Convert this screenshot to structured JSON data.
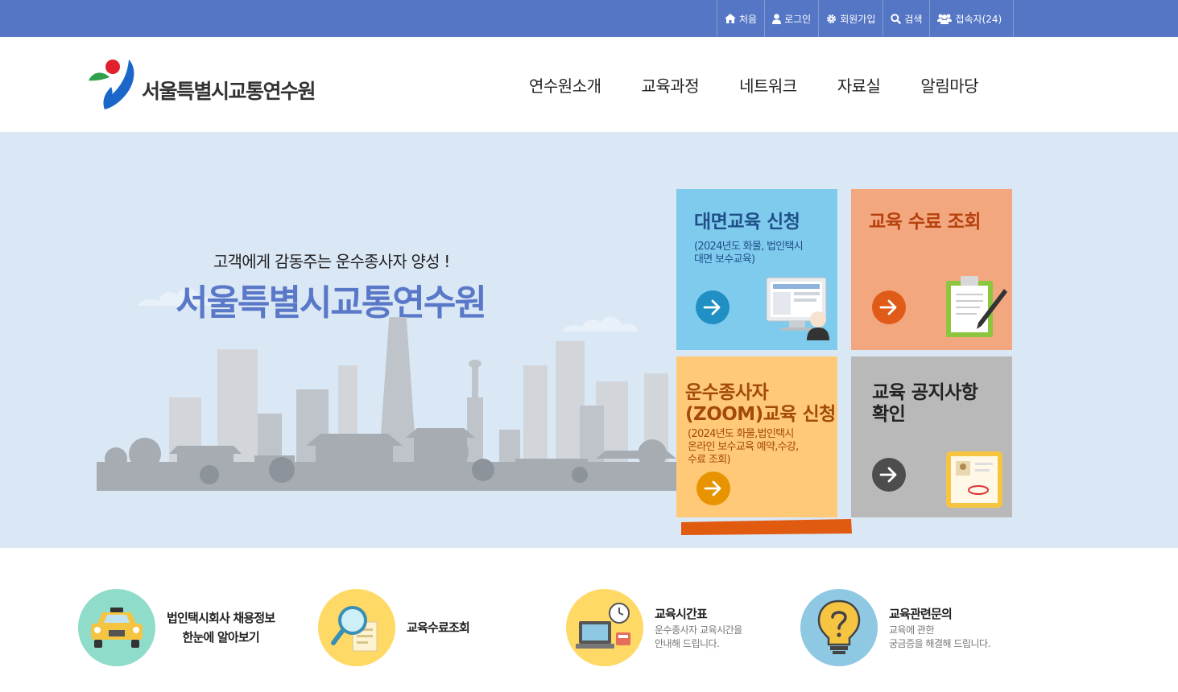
{
  "topbar": {
    "links": [
      {
        "label": "처음",
        "icon": "home-icon"
      },
      {
        "label": "로그인",
        "icon": "user-icon"
      },
      {
        "label": "회원가입",
        "icon": "gear-icon"
      },
      {
        "label": "검색",
        "icon": "search-icon"
      },
      {
        "label": "접속자(24)",
        "icon": "users-icon"
      }
    ]
  },
  "header": {
    "logo_text": "서울특별시교통연수원",
    "nav": [
      "연수원소개",
      "교육과정",
      "네트워크",
      "자료실",
      "알림마당"
    ]
  },
  "hero": {
    "subtitle": "고객에게 감동주는 운수종사자 양성 !",
    "title": "서울특별시교통연수원"
  },
  "tiles": [
    {
      "title": "대면교육 신청",
      "desc_lines": [
        "(2024년도 화물, 법인택시",
        "대면 보수교육)"
      ],
      "bg": "#7fcbed",
      "arrow_color": "#1f8fc4",
      "icon": "computer-user-icon"
    },
    {
      "title": "교육 수료 조회",
      "desc_lines": [],
      "bg": "#f3a77f",
      "arrow_color": "#e05b18",
      "icon": "clipboard-pen-icon"
    },
    {
      "title_lines": [
        "운수종사자",
        "(ZOOM)교육 신청"
      ],
      "desc_lines": [
        "(2024년도 화물,법인택시",
        "온라인 보수교육 예약,수강,",
        "수료 조회)"
      ],
      "bg": "#ffc978",
      "arrow_color": "#e89400",
      "icon": "arrow-icon"
    },
    {
      "title_lines": [
        "교육 공지사항",
        "확인"
      ],
      "desc_lines": [],
      "bg": "#b9b9b9",
      "arrow_color": "#4d4d4d",
      "icon": "folder-document-icon"
    }
  ],
  "quick_links": [
    {
      "title_lines": [
        "법인택시회사 채용정보",
        "한눈에 알아보기"
      ],
      "desc_lines": [],
      "circle_color": "#8fdccb",
      "icon": "taxi-icon"
    },
    {
      "title_lines": [
        "교육수료조회"
      ],
      "desc_lines": [],
      "circle_color": "#ffd966",
      "icon": "magnifier-document-icon"
    },
    {
      "title_lines": [
        "교육시간표"
      ],
      "desc_lines": [
        "운수종사자 교육시간을",
        "안내해 드립니다."
      ],
      "circle_color": "#ffd966",
      "icon": "clock-computer-icon"
    },
    {
      "title_lines": [
        "교육관련문의"
      ],
      "desc_lines": [
        "교육에 관한",
        "궁금증을 해결해 드립니다."
      ],
      "circle_color": "#8ec8e3",
      "icon": "question-bulb-icon"
    }
  ],
  "colors": {
    "topbar": "#5476c4",
    "hero_bg": "#dae7f5",
    "hero_title": "#5a78c8",
    "highlight_mark": "#e05a10"
  }
}
